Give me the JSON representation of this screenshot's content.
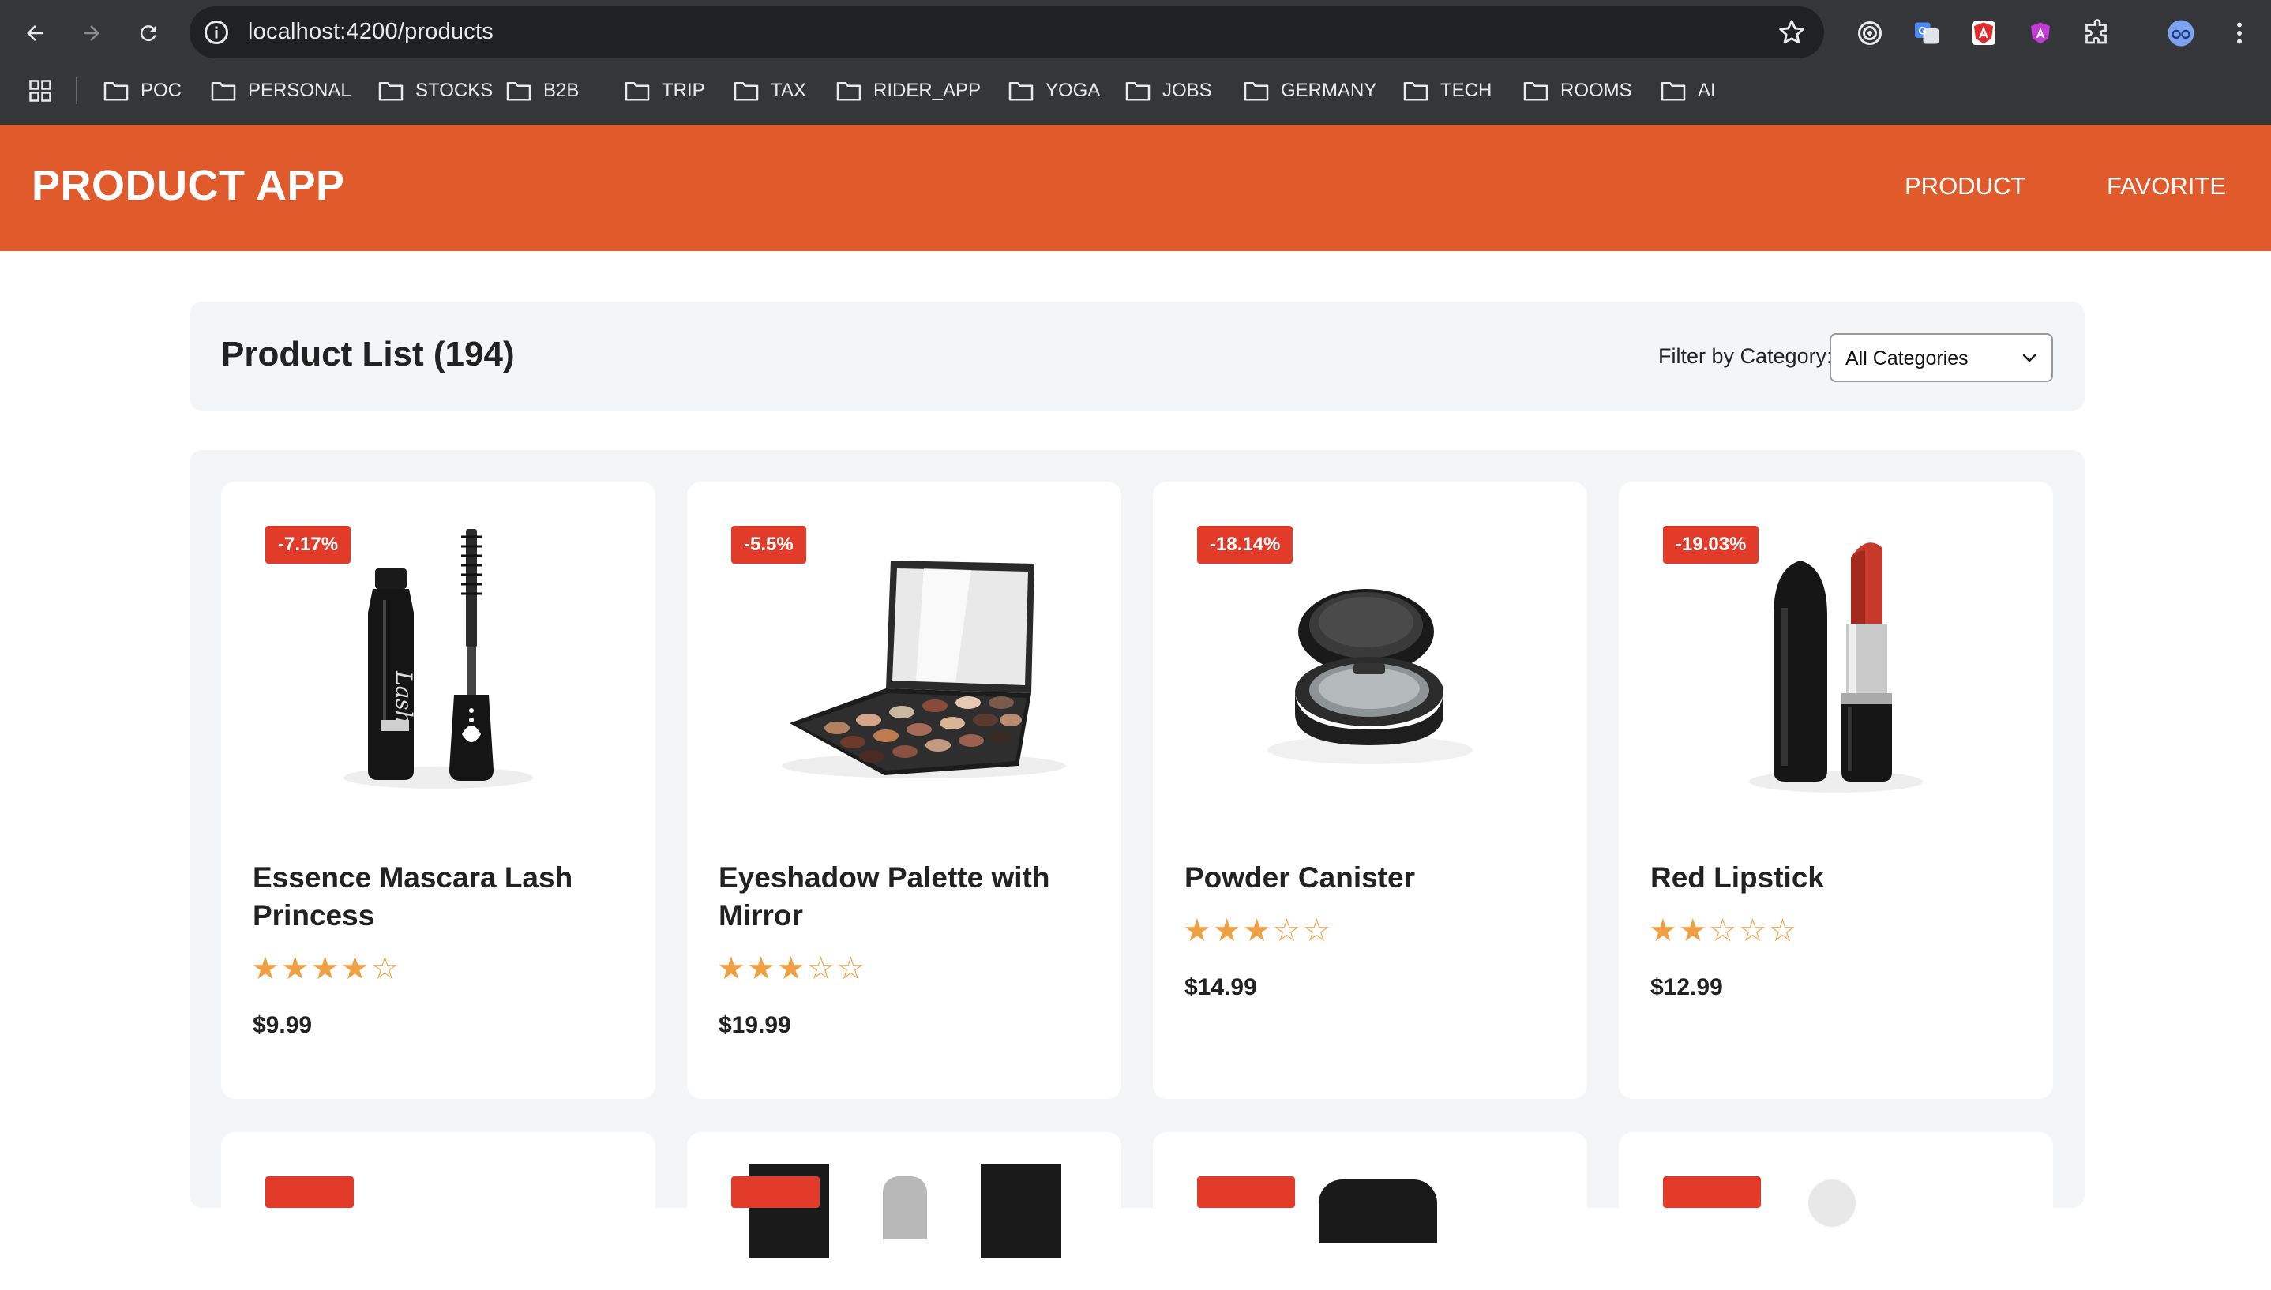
{
  "browser": {
    "url": "localhost:4200/products",
    "bookmarks": [
      "POC",
      "PERSONAL",
      "STOCKS",
      "B2B",
      "TRIP",
      "TAX",
      "RIDER_APP",
      "YOGA",
      "JOBS",
      "GERMANY",
      "TECH",
      "ROOMS",
      "AI"
    ]
  },
  "header": {
    "brand": "PRODUCT APP",
    "nav": [
      "PRODUCT",
      "FAVORITE"
    ],
    "color": "#e15a2c"
  },
  "list": {
    "title": "Product List (194)",
    "filter_label": "Filter by Category:",
    "filter_value": "All Categories"
  },
  "products": [
    {
      "name": "Essence Mascara Lash Princess",
      "discount": "-7.17%",
      "rating": 4,
      "stars": "★★★★☆",
      "price": "$9.99",
      "image": "mascara"
    },
    {
      "name": "Eyeshadow Palette with Mirror",
      "discount": "-5.5%",
      "rating": 3,
      "stars": "★★★☆☆",
      "price": "$19.99",
      "image": "eyeshadow-palette"
    },
    {
      "name": "Powder Canister",
      "discount": "-18.14%",
      "rating": 3,
      "stars": "★★★☆☆",
      "price": "$14.99",
      "image": "powder-compact"
    },
    {
      "name": "Red Lipstick",
      "discount": "-19.03%",
      "rating": 2,
      "stars": "★★☆☆☆",
      "price": "$12.99",
      "image": "lipstick"
    }
  ],
  "colors": {
    "badge": "#e33b2a",
    "star": "#f0a042",
    "page_bg": "#f4f5f7"
  }
}
